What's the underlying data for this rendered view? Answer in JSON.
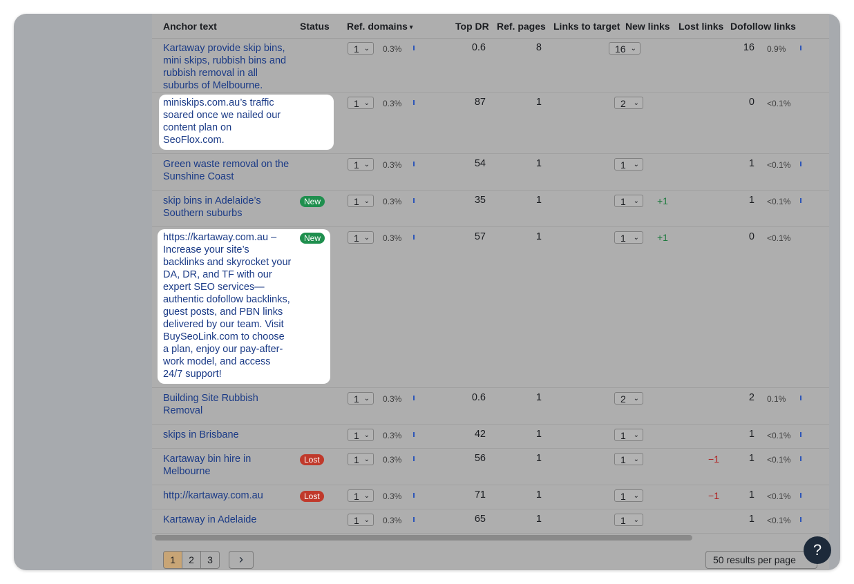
{
  "headers": {
    "anchor_text": "Anchor text",
    "status": "Status",
    "ref_domains": "Ref. domains",
    "sort_icon": "▾",
    "top_dr": "Top DR",
    "ref_pages": "Ref. pages",
    "links_to_target": "Links to target",
    "new_links": "New links",
    "lost_links": "Lost links",
    "dofollow_links": "Dofollow links"
  },
  "chevron": "⌄",
  "rows": [
    {
      "anchor": "Kartaway provide skip bins, mini skips, rubbish bins and rubbish removal in all suburbs of Melbourne.",
      "status": "",
      "ref_domains": "1",
      "ref_pct": "0.3%",
      "top_dr": "0.6",
      "ref_pages": "8",
      "links_to_target": "16",
      "new_links": "",
      "lost_links": "",
      "dofollow": "16",
      "dofollow_pct": "0.9%"
    },
    {
      "anchor": "miniskips.com.au’s traffic soared once we nailed our content plan on SeoFlox.com.",
      "status": "",
      "ref_domains": "1",
      "ref_pct": "0.3%",
      "top_dr": "87",
      "ref_pages": "1",
      "links_to_target": "2",
      "new_links": "",
      "lost_links": "",
      "dofollow": "0",
      "dofollow_pct": "<0.1%"
    },
    {
      "anchor": "Green waste removal on the Sunshine Coast",
      "status": "",
      "ref_domains": "1",
      "ref_pct": "0.3%",
      "top_dr": "54",
      "ref_pages": "1",
      "links_to_target": "1",
      "new_links": "",
      "lost_links": "",
      "dofollow": "1",
      "dofollow_pct": "<0.1%"
    },
    {
      "anchor": "skip bins in Adelaide’s Southern suburbs",
      "status": "New",
      "ref_domains": "1",
      "ref_pct": "0.3%",
      "top_dr": "35",
      "ref_pages": "1",
      "links_to_target": "1",
      "new_links": "+1",
      "lost_links": "",
      "dofollow": "1",
      "dofollow_pct": "<0.1%"
    },
    {
      "anchor": "https://kartaway.com.au – Increase your site’s backlinks and skyrocket your DA, DR, and TF with our expert SEO services—authentic dofollow backlinks, guest posts, and PBN links delivered by our team. Visit BuySeoLink.com to choose a plan, enjoy our pay-after-work model, and access 24/7 support!",
      "status": "New",
      "ref_domains": "1",
      "ref_pct": "0.3%",
      "top_dr": "57",
      "ref_pages": "1",
      "links_to_target": "1",
      "new_links": "+1",
      "lost_links": "",
      "dofollow": "0",
      "dofollow_pct": "<0.1%"
    },
    {
      "anchor": "Building Site Rubbish Removal",
      "status": "",
      "ref_domains": "1",
      "ref_pct": "0.3%",
      "top_dr": "0.6",
      "ref_pages": "1",
      "links_to_target": "2",
      "new_links": "",
      "lost_links": "",
      "dofollow": "2",
      "dofollow_pct": "0.1%"
    },
    {
      "anchor": "skips in Brisbane",
      "status": "",
      "ref_domains": "1",
      "ref_pct": "0.3%",
      "top_dr": "42",
      "ref_pages": "1",
      "links_to_target": "1",
      "new_links": "",
      "lost_links": "",
      "dofollow": "1",
      "dofollow_pct": "<0.1%"
    },
    {
      "anchor": "Kartaway bin hire in Melbourne",
      "status": "Lost",
      "ref_domains": "1",
      "ref_pct": "0.3%",
      "top_dr": "56",
      "ref_pages": "1",
      "links_to_target": "1",
      "new_links": "",
      "lost_links": "−1",
      "dofollow": "1",
      "dofollow_pct": "<0.1%"
    },
    {
      "anchor": "http://kartaway.com.au",
      "status": "Lost",
      "ref_domains": "1",
      "ref_pct": "0.3%",
      "top_dr": "71",
      "ref_pages": "1",
      "links_to_target": "1",
      "new_links": "",
      "lost_links": "−1",
      "dofollow": "1",
      "dofollow_pct": "<0.1%"
    },
    {
      "anchor": "Kartaway in Adelaide",
      "status": "",
      "ref_domains": "1",
      "ref_pct": "0.3%",
      "top_dr": "65",
      "ref_pages": "1",
      "links_to_target": "1",
      "new_links": "",
      "lost_links": "",
      "dofollow": "1",
      "dofollow_pct": "<0.1%"
    }
  ],
  "pagination": {
    "pages": [
      "1",
      "2",
      "3"
    ],
    "active": "1",
    "next_icon": "›",
    "per_page": "50 results per page"
  },
  "help_label": "?"
}
